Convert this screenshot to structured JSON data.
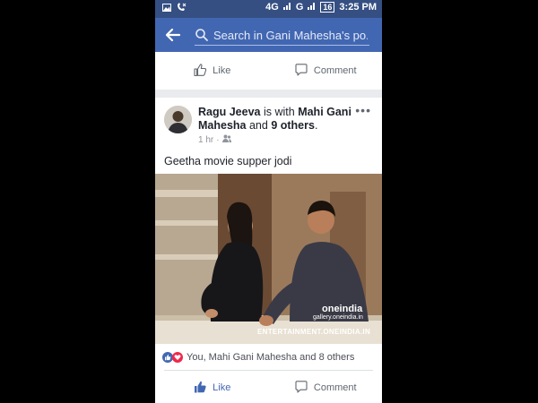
{
  "status_bar": {
    "network": "4G",
    "network2": "G",
    "battery": "16",
    "time": "3:25 PM"
  },
  "search": {
    "placeholder": "Search in Gani Mahesha's po..."
  },
  "top_actions": {
    "like": "Like",
    "comment": "Comment"
  },
  "post": {
    "author": "Ragu Jeeva",
    "with_text": "is with",
    "tagged": "Mahi Gani Mahesha",
    "and_text": "and",
    "others": "9 others",
    "time": "1 hr",
    "message": "Geetha movie supper jodi",
    "watermark_logo": "oneindia",
    "watermark_gallery": "gallery.oneindia.in",
    "watermark_site": "ENTERTAINMENT.ONEINDIA.IN",
    "reactions_text": "You, Mahi Gani Mahesha and 8 others",
    "like": "Like",
    "comment": "Comment"
  },
  "colors": {
    "brand": "#4267b2",
    "status_bar": "#354f82",
    "like_active": "#4267b2"
  }
}
